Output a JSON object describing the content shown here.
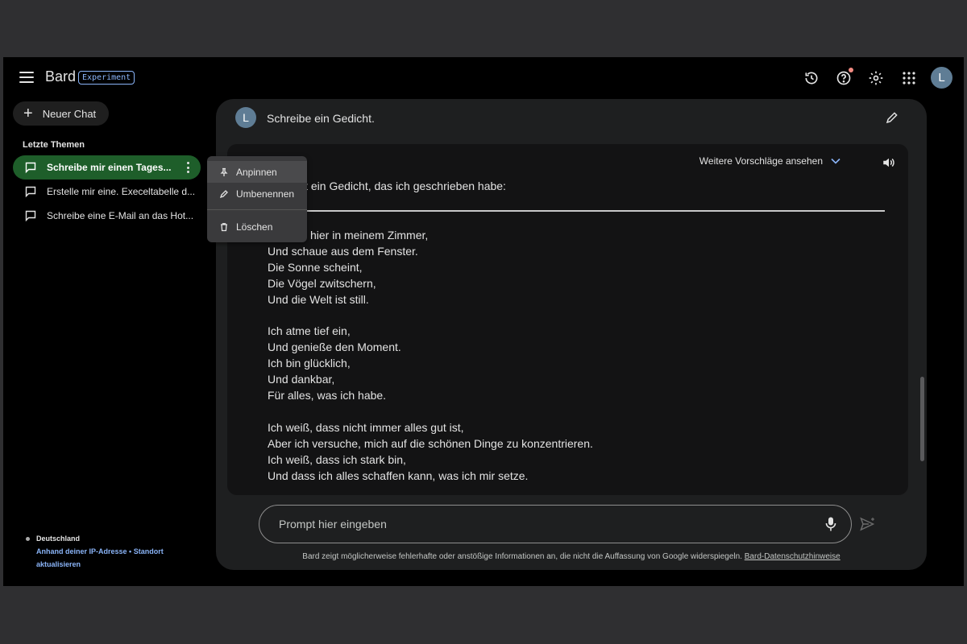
{
  "header": {
    "app_name": "Bard",
    "badge": "Experiment",
    "icons": [
      "menu-icon",
      "history-icon",
      "help-icon",
      "settings-icon",
      "apps-icon"
    ],
    "avatar_letter": "L"
  },
  "sidebar": {
    "new_chat_label": "Neuer Chat",
    "recent_title": "Letzte Themen",
    "topics": [
      {
        "label": "Schreibe mir einen Tages..."
      },
      {
        "label": "Erstelle mir eine. Execeltabelle d..."
      },
      {
        "label": "Schreibe eine E-Mail an das Hot..."
      }
    ],
    "context_menu": {
      "pin": "Anpinnen",
      "rename": "Umbenennen",
      "delete": "Löschen"
    },
    "location": {
      "country": "Deutschland",
      "source": "Anhand deiner IP-Adresse",
      "separator": "•",
      "update": "Standort",
      "update2": "aktualisieren"
    }
  },
  "chat": {
    "user_avatar": "L",
    "question": "Schreibe ein Gedicht.",
    "drafts_label": "Weitere Vorschläge ansehen",
    "intro": "ist ein Gedicht, das ich geschrieben habe:",
    "poem": [
      [
        "hier in meinem Zimmer,",
        "Und schaue aus dem Fenster.",
        "Die Sonne scheint,",
        "Die Vögel zwitschern,",
        "Und die Welt ist still."
      ],
      [
        "Ich atme tief ein,",
        "Und genieße den Moment.",
        "Ich bin glücklich,",
        "Und dankbar,",
        "Für alles, was ich habe."
      ],
      [
        "Ich weiß, dass nicht immer alles gut ist,",
        "Aber ich versuche, mich auf die schönen Dinge zu konzentrieren.",
        "Ich weiß, dass ich stark bin,",
        "Und dass ich alles schaffen kann, was ich mir setze."
      ]
    ]
  },
  "prompt": {
    "placeholder": "Prompt hier eingeben"
  },
  "disclaimer": {
    "text": "Bard zeigt möglicherweise fehlerhafte oder anstößige Informationen an, die nicht die Auffassung von Google widerspiegeln.",
    "link": "Bard-Datenschutzhinweise"
  },
  "colors": {
    "background": "#000000",
    "panel": "#1e1f20",
    "active_topic": "#1e5e2a",
    "accent_link": "#8ab4f8",
    "notification_dot": "#f28b82"
  }
}
